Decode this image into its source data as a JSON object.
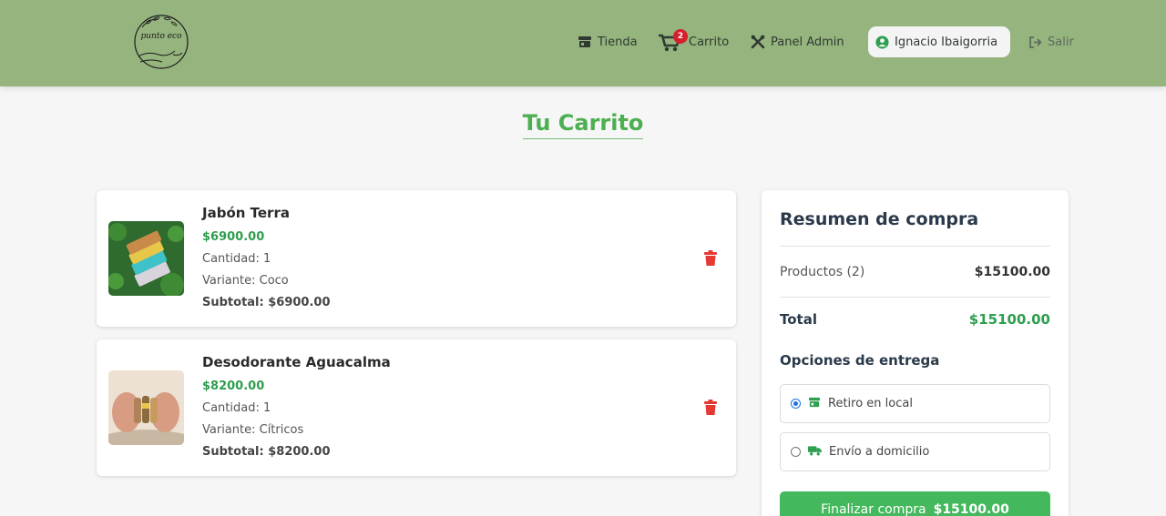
{
  "brand": {
    "logo_text": "punto eco"
  },
  "nav": {
    "tienda": "Tienda",
    "carrito": "Carrito",
    "cart_count": "2",
    "admin": "Panel Admin",
    "user": "Ignacio Ibaigorria",
    "salir": "Salir"
  },
  "page": {
    "title": "Tu Carrito"
  },
  "cart": {
    "items": [
      {
        "name": "Jabón Terra",
        "price": "$6900.00",
        "quantity": "Cantidad: 1",
        "variant": "Variante: Coco",
        "subtotal": "Subtotal: $6900.00"
      },
      {
        "name": "Desodorante Aguacalma",
        "price": "$8200.00",
        "quantity": "Cantidad: 1",
        "variant": "Variante: Cítricos",
        "subtotal": "Subtotal: $8200.00"
      }
    ]
  },
  "summary": {
    "title": "Resumen de compra",
    "products_label": "Productos (2)",
    "products_value": "$15100.00",
    "total_label": "Total",
    "total_value": "$15100.00",
    "delivery_title": "Opciones de entrega",
    "options": [
      "Retiro en local",
      "Envío a domicilio"
    ],
    "selected_option": "Retiro en local",
    "checkout_label": "Finalizar compra",
    "checkout_amount": "$15100.00"
  },
  "colors": {
    "navbar": "#96b47e",
    "accent_green": "#4caf50",
    "price_green": "#2e9e4f",
    "button_green": "#43b85c",
    "delete_red": "#e53935",
    "badge_red": "#d61f2a"
  },
  "icons": {
    "tienda": "store-icon",
    "carrito": "cart-icon",
    "admin": "tools-icon",
    "user": "user-circle-icon",
    "salir": "logout-icon",
    "delete": "trash-icon",
    "pickup": "store-icon",
    "shipping": "truck-icon"
  }
}
